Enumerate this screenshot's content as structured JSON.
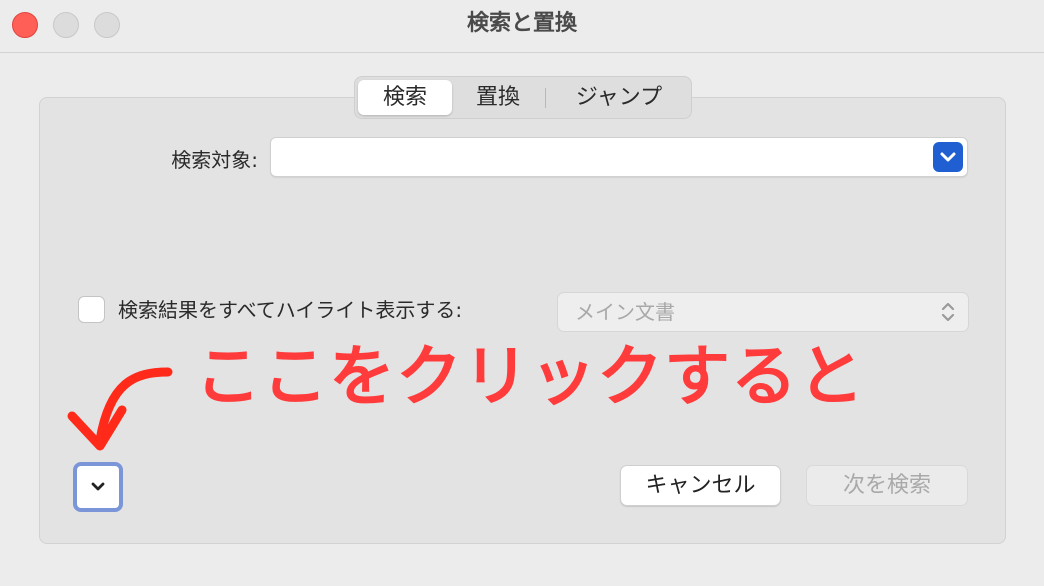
{
  "window": {
    "title": "検索と置換"
  },
  "tabs": [
    {
      "label": "検索",
      "selected": true
    },
    {
      "label": "置換",
      "selected": false
    },
    {
      "label": "ジャンプ",
      "selected": false
    }
  ],
  "find": {
    "label": "検索対象:",
    "value": ""
  },
  "highlight": {
    "label": "検索結果をすべてハイライト表示する:",
    "checked": false,
    "select_value": "メイン文書"
  },
  "annotation": {
    "text": "ここをクリックすると"
  },
  "buttons": {
    "cancel": "キャンセル",
    "find_next": "次を検索"
  },
  "colors": {
    "accent": "#1f5fd1",
    "annotation": "#ff3b3b",
    "close": "#ff5f57"
  }
}
